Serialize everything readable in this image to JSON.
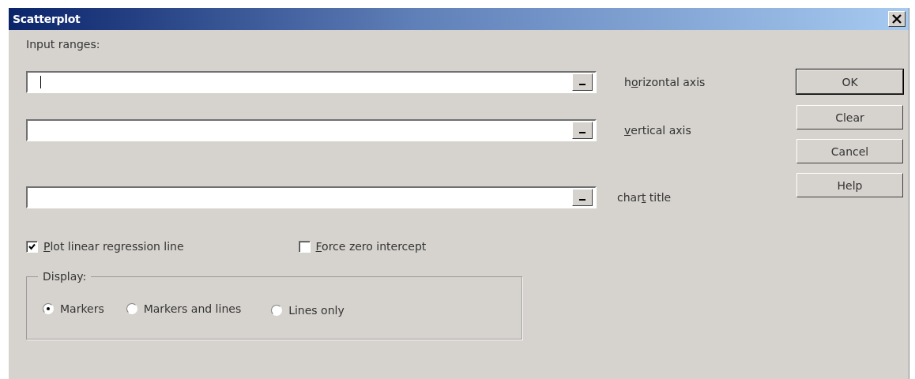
{
  "window": {
    "title": "Scatterplot"
  },
  "section_label": "Input ranges:",
  "ranges": [
    {
      "label_before": "h",
      "access_key": "o",
      "label_after": "rizontal axis",
      "focused": true
    },
    {
      "access_key": "v",
      "label_after": "ertical axis",
      "focused": false
    },
    {
      "label_before": "char",
      "access_key": "t",
      "label_after": " title",
      "focused": false
    }
  ],
  "buttons": [
    {
      "label": "OK",
      "default": true
    },
    {
      "label": "Clear",
      "default": false
    },
    {
      "label": "Cancel",
      "default": false
    },
    {
      "label": "Help",
      "default": false
    }
  ],
  "options": [
    {
      "access_key": "P",
      "label_after": "lot linear regression line",
      "checked": true
    },
    {
      "access_key": "F",
      "label_after": "orce zero intercept",
      "checked": false
    }
  ],
  "display": {
    "legend": "Display:",
    "choices": [
      {
        "label": "Markers",
        "selected": true
      },
      {
        "label": "Markers and lines",
        "selected": false
      },
      {
        "label": "Lines only",
        "selected": false
      }
    ]
  }
}
